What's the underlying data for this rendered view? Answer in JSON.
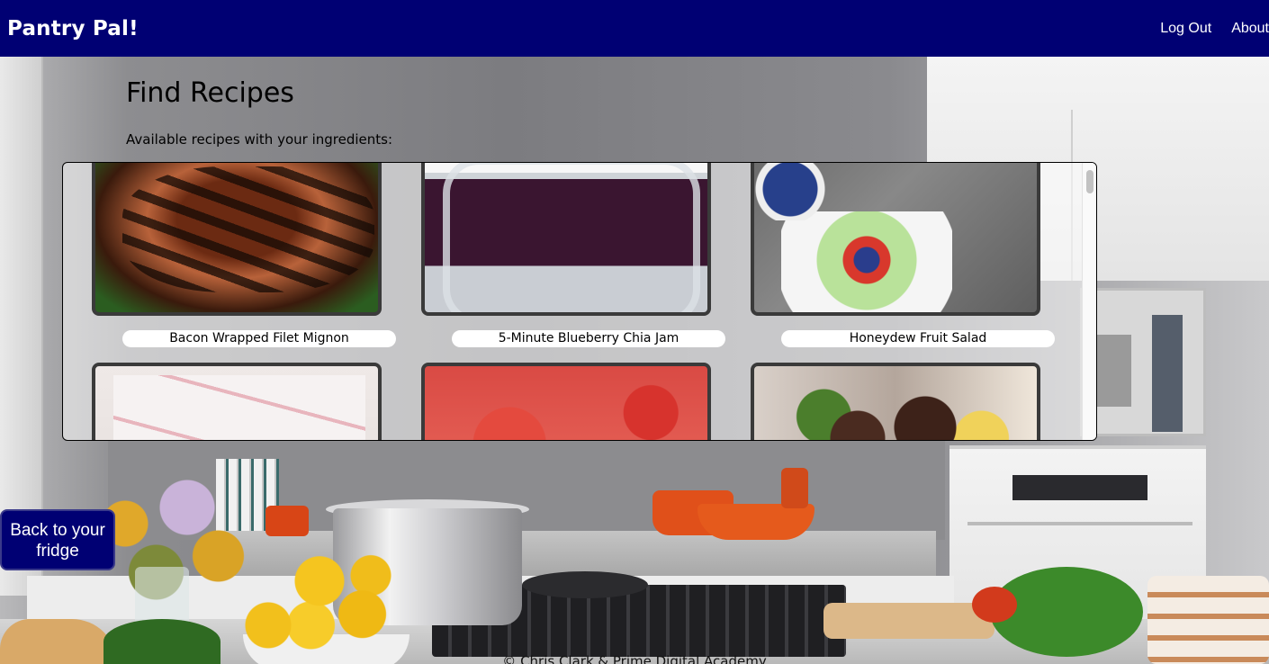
{
  "header": {
    "brand": "Pantry Pal!",
    "nav": [
      {
        "label": "Log Out"
      },
      {
        "label": "About"
      }
    ]
  },
  "page": {
    "title": "Find Recipes",
    "subheading": "Available recipes with your ingredients:"
  },
  "recipes": [
    {
      "title": "Bacon Wrapped Filet Mignon"
    },
    {
      "title": "5-Minute Blueberry Chia Jam"
    },
    {
      "title": "Honeydew Fruit Salad"
    },
    {
      "title": ""
    },
    {
      "title": ""
    },
    {
      "title": ""
    }
  ],
  "back_button": {
    "label_line1": "Back to your",
    "label_line2": "fridge"
  },
  "footer": {
    "text": "© Chris Clark & Prime Digital Academy"
  },
  "colors": {
    "header_bg": "#000073",
    "header_text": "#ffffff",
    "card_border": "#3a3a3a"
  }
}
